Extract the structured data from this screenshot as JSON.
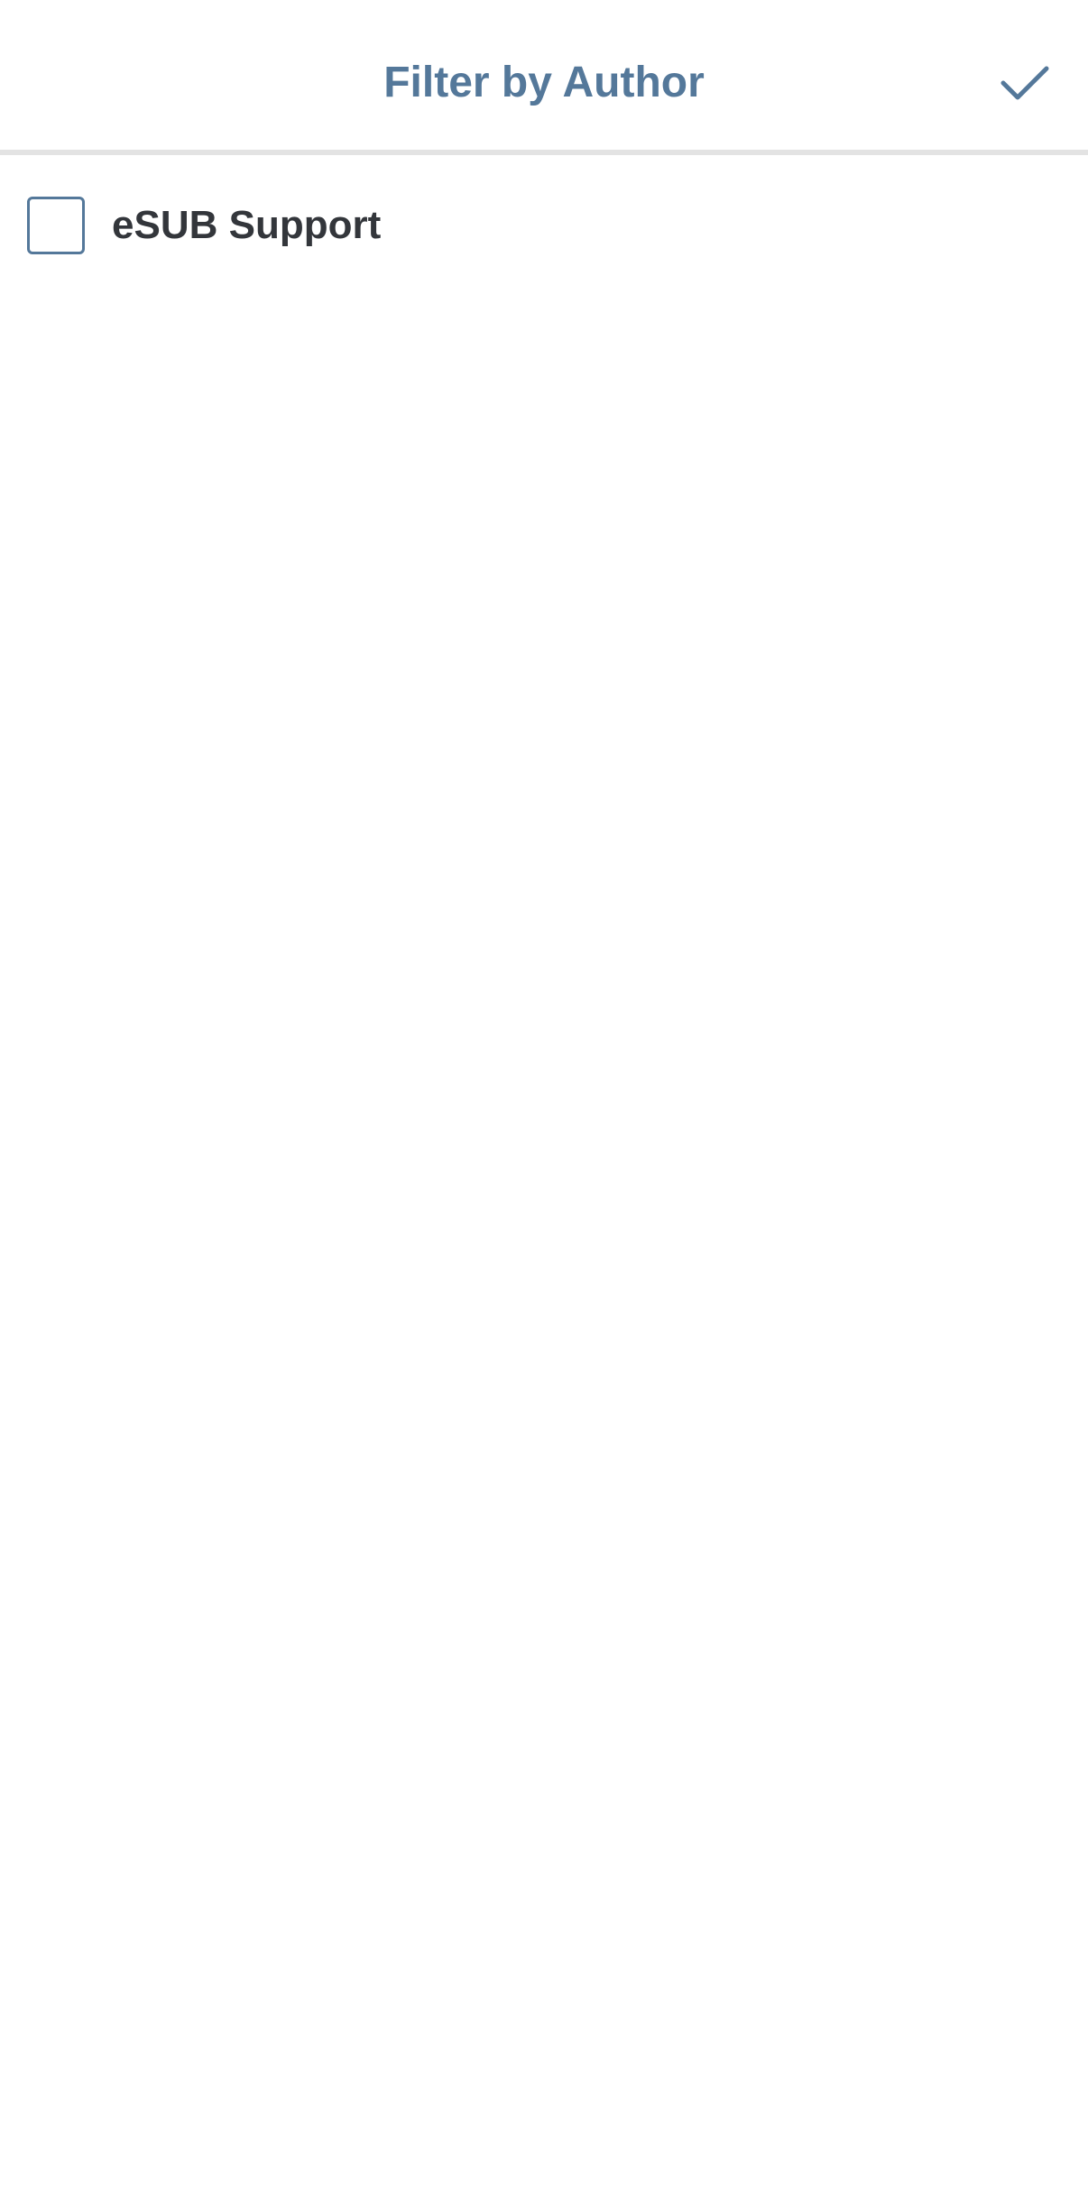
{
  "header": {
    "title": "Filter by Author",
    "confirm_icon": "checkmark-icon"
  },
  "authors": [
    {
      "label": "eSUB Support",
      "checked": false
    }
  ],
  "colors": {
    "accent": "#54789a",
    "text": "#33363b",
    "divider": "#e3e3e3"
  }
}
